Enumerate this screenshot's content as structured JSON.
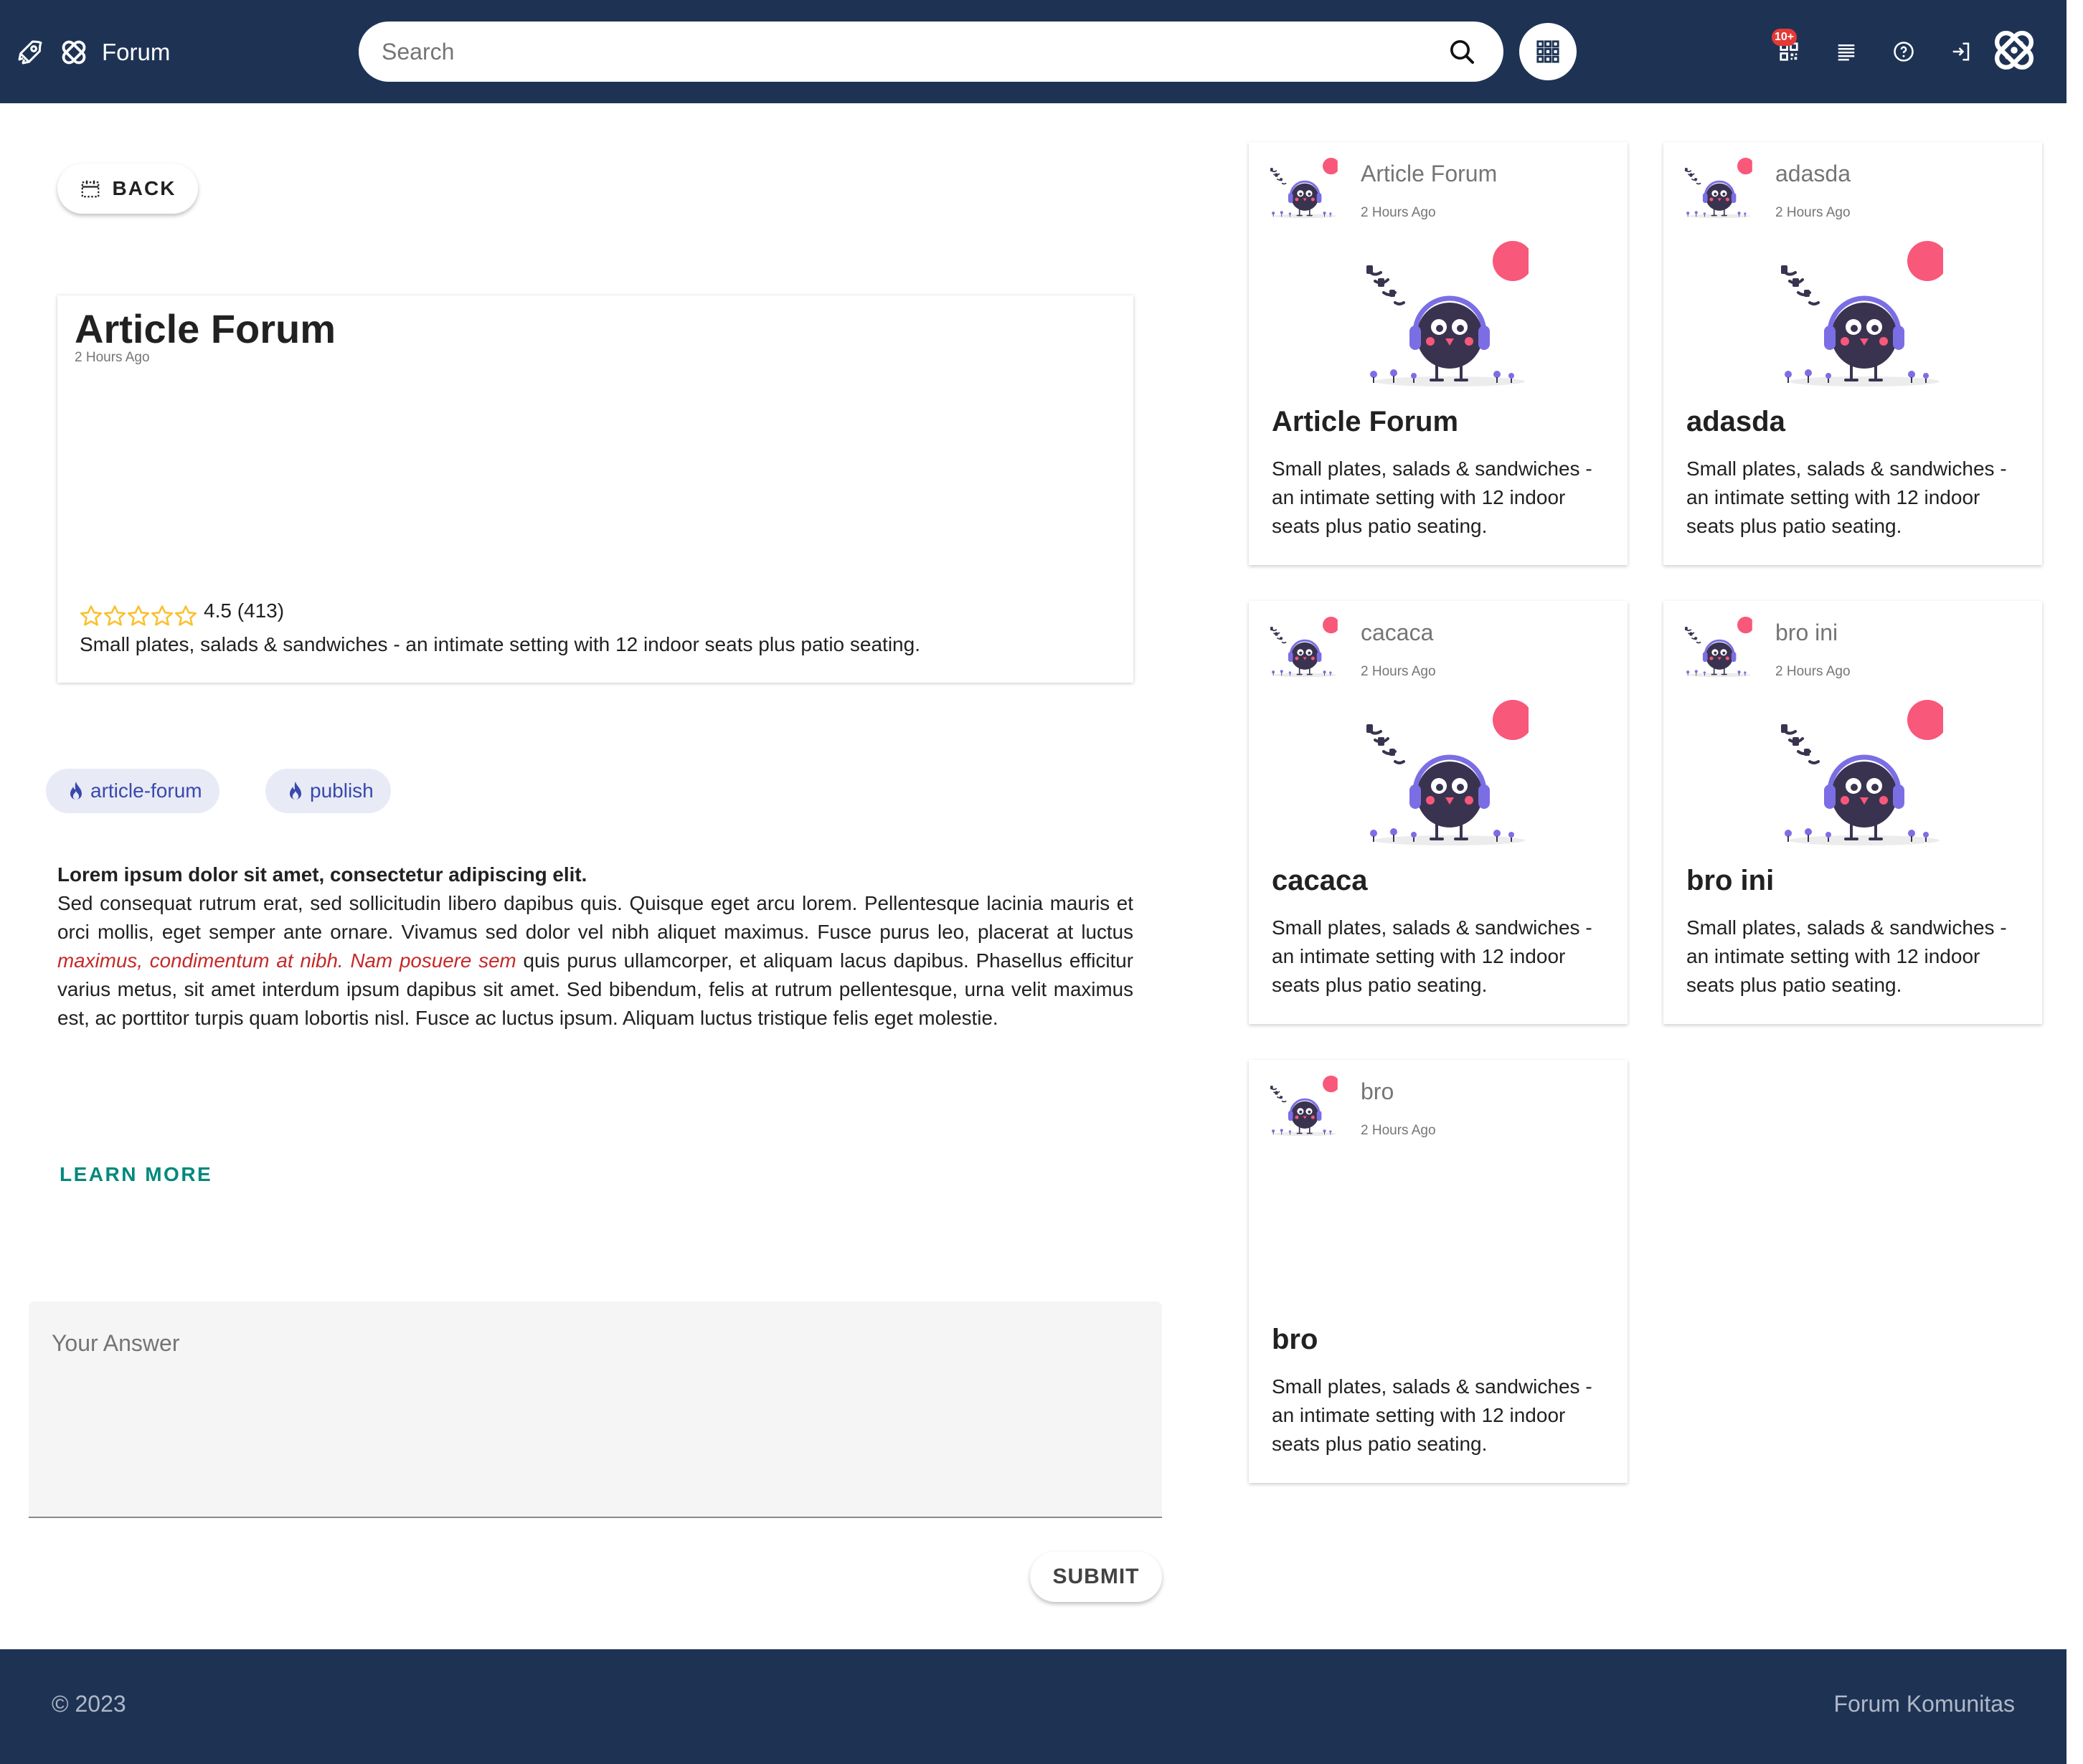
{
  "app": {
    "name": "Forum"
  },
  "header": {
    "search_placeholder": "Search",
    "notification_badge": "10+"
  },
  "back_button": {
    "label": "BACK"
  },
  "article": {
    "title": "Article Forum",
    "time": "2 Hours Ago",
    "rating": 4.5,
    "rating_text": "4.5 (413)",
    "description": "Small plates, salads & sandwiches - an intimate setting with 12 indoor seats plus patio seating."
  },
  "tags": [
    "article-forum",
    "publish"
  ],
  "body": {
    "lead": "Lorem ipsum dolor sit amet, consectetur adipiscing elit.",
    "p1": "Sed consequat rutrum erat, sed sollicitudin libero dapibus quis. Quisque eget arcu lorem. Pellentesque lacinia mauris et orci mollis, eget semper ante ornare. Vivamus sed dolor vel nibh aliquet maximus. Fusce purus leo, placerat at luctus ",
    "emphasis": "maximus, condimentum at nibh. Nam posuere sem",
    "p2": " quis purus ullamcorper, et aliquam lacus dapibus. Phasellus efficitur varius metus, sit amet interdum ipsum dapibus sit amet. Sed bibendum, felis at rutrum pellentesque, urna velit maximus est, ac porttitor turpis quam lobortis nisl. Fusce ac luctus ipsum. Aliquam luctus tristique felis eget molestie."
  },
  "learn_more": "LEARN MORE",
  "answer": {
    "placeholder": "Your Answer",
    "submit_label": "SUBMIT"
  },
  "related": [
    {
      "name": "Article Forum",
      "time": "2 Hours Ago",
      "title": "Article Forum",
      "description": "Small plates, salads & sandwiches - an intimate setting with 12 indoor seats plus patio seating.",
      "has_image": true
    },
    {
      "name": "adasda",
      "time": "2 Hours Ago",
      "title": "adasda",
      "description": "Small plates, salads & sandwiches - an intimate setting with 12 indoor seats plus patio seating.",
      "has_image": true
    },
    {
      "name": "cacaca",
      "time": "2 Hours Ago",
      "title": "cacaca",
      "description": "Small plates, salads & sandwiches - an intimate setting with 12 indoor seats plus patio seating.",
      "has_image": true
    },
    {
      "name": "bro ini",
      "time": "2 Hours Ago",
      "title": "bro ini",
      "description": "Small plates, salads & sandwiches - an intimate setting with 12 indoor seats plus patio seating.",
      "has_image": true
    },
    {
      "name": "bro",
      "time": "2 Hours Ago",
      "title": "bro",
      "description": "Small plates, salads & sandwiches - an intimate setting with 12 indoor seats plus patio seating.",
      "has_image": false
    }
  ],
  "footer": {
    "copyright": "© 2023",
    "site": "Forum Komunitas"
  },
  "colors": {
    "topbar": "#1e3354",
    "accent": "#00897b",
    "chip_bg": "#e8eaf6",
    "chip_text": "#3949ab",
    "star": "#fbc02d",
    "emphasis": "#c62828",
    "bird_dot": "#f8587a"
  },
  "icons": [
    "rocket-icon",
    "logo-icon",
    "search-icon",
    "apps-grid-icon",
    "qr-code-icon",
    "list-icon",
    "help-icon",
    "logout-icon",
    "user-avatar-icon",
    "calendar-icon",
    "star-icon",
    "fire-icon"
  ]
}
